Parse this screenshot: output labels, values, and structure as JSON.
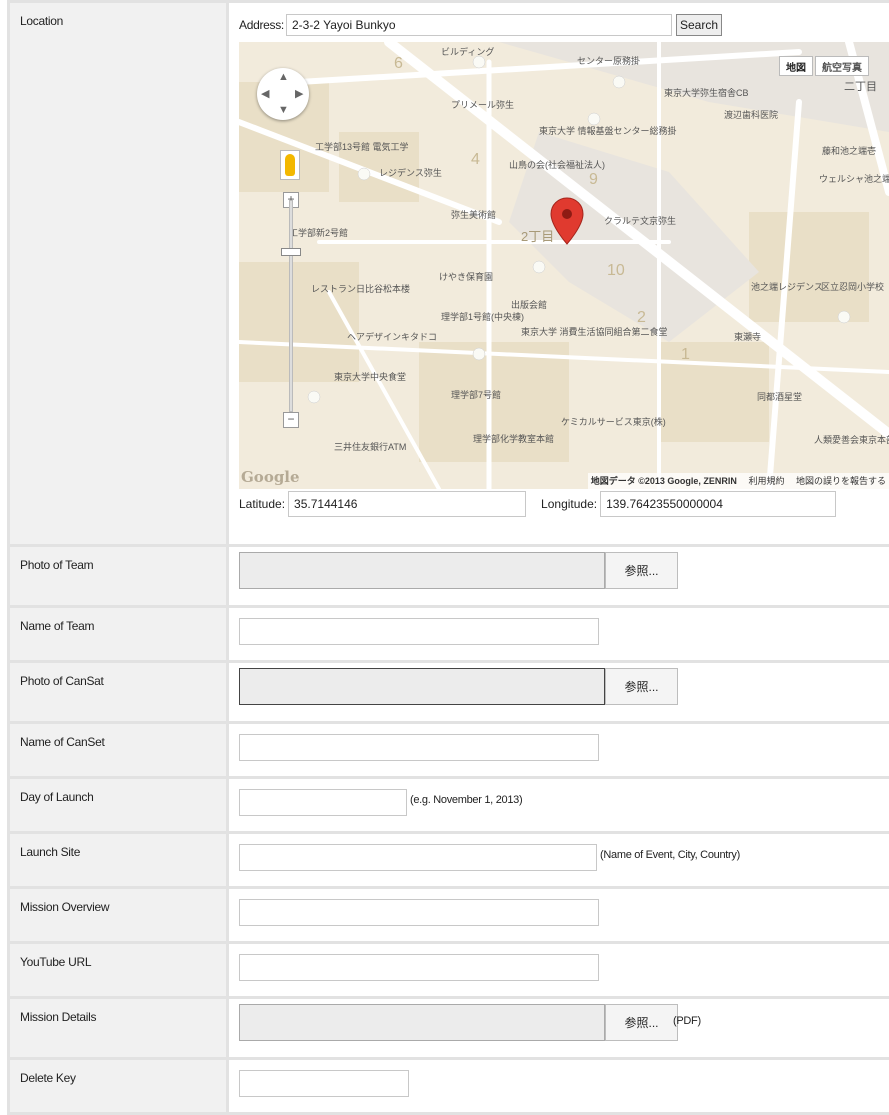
{
  "location": {
    "label": "Location",
    "address_label": "Address:",
    "address_value": "2-3-2 Yayoi Bunkyo",
    "search_label": "Search",
    "latitude_label": "Latitude:",
    "latitude_value": "35.7144146",
    "longitude_label": "Longitude:",
    "longitude_value": "139.76423550000004",
    "map": {
      "map_type_map": "地図",
      "map_type_satellite": "航空写真",
      "google_mark": "Google",
      "copyright": "地図データ ©2013 Google, ZENRIN",
      "terms_link": "利用規約",
      "report_link": "地図の誤りを報告する",
      "zoom_in": "+",
      "zoom_out": "−",
      "marker_color": "#e03a2f",
      "map_labels": [
        "ビルディング",
        "センター原務掛",
        "プリメール弥生",
        "東京大学 情報基盤センター総務掛",
        "山鳥の会(社会福祉法人)",
        "工学部13号館 電気工学",
        "レジデンス弥生",
        "弥生美術館",
        "クラルテ文京弥生",
        "東京大学弥生宿舎CB",
        "渡辺歯科医院",
        "藤和池之端壱",
        "ウェルシャ池之端",
        "工学部新2号館",
        "レストラン日比谷松本楼",
        "けやき保育園",
        "出版会館",
        "理学部1号館(中央棟)",
        "東京大学 消費生活協同組合第二食堂",
        "池之端レジデンス",
        "区立忍岡小学校",
        "ヘアデザインキタドコ",
        "東京大学中央食堂",
        "東瀬寺",
        "理学部7号館",
        "ケミカルサービス東京(株)",
        "同都酒星堂",
        "三井住友銀行ATM",
        "理学部化学教室本館",
        "人類愛善会東京本部",
        "2丁目",
        "二丁目"
      ]
    }
  },
  "fields": [
    {
      "label": "Photo of Team",
      "type": "file",
      "browse": "参照..."
    },
    {
      "label": "Name of Team",
      "type": "text",
      "value": ""
    },
    {
      "label": "Photo of CanSat",
      "type": "file",
      "browse": "参照..."
    },
    {
      "label": "Name of CanSet",
      "type": "text",
      "value": ""
    },
    {
      "label": "Day of Launch",
      "type": "text",
      "value": "",
      "hint": "(e.g. November 1, 2013)"
    },
    {
      "label": "Launch Site",
      "type": "text",
      "value": "",
      "hint": "(Name of Event, City, Country)"
    },
    {
      "label": "Mission Overview",
      "type": "text",
      "value": ""
    },
    {
      "label": "YouTube URL",
      "type": "text",
      "value": ""
    },
    {
      "label": "Mission Details",
      "type": "file",
      "browse": "参照...",
      "hint": "(PDF)"
    },
    {
      "label": "Delete Key",
      "type": "text",
      "value": ""
    }
  ]
}
